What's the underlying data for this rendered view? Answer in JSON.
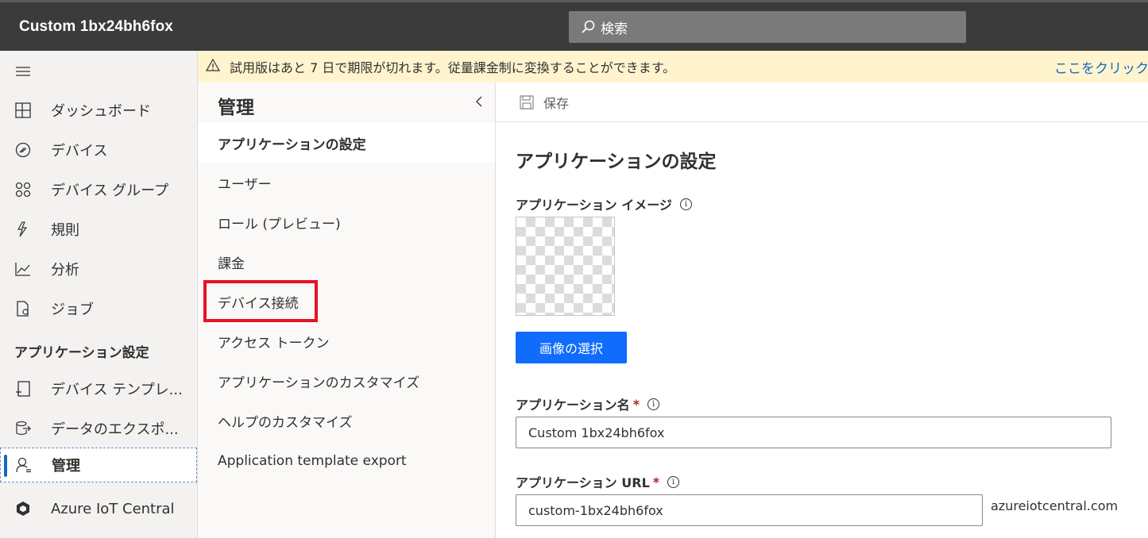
{
  "app": {
    "title": "Custom 1bx24bh6fox"
  },
  "search": {
    "placeholder": "検索"
  },
  "banner": {
    "message": "試用版はあと 7 日で期限が切れます。従量課金制に変換することができます。",
    "link": "ここをクリック"
  },
  "leftnav": {
    "items": [
      {
        "label": "ダッシュボード",
        "icon": "dashboard-icon"
      },
      {
        "label": "デバイス",
        "icon": "device-icon"
      },
      {
        "label": "デバイス グループ",
        "icon": "device-group-icon"
      },
      {
        "label": "規則",
        "icon": "rules-icon"
      },
      {
        "label": "分析",
        "icon": "analytics-icon"
      },
      {
        "label": "ジョブ",
        "icon": "jobs-icon"
      }
    ],
    "section_label": "アプリケーション設定",
    "settings_items": [
      {
        "label": "デバイス テンプレ...",
        "icon": "device-template-icon"
      },
      {
        "label": "データのエクスポ...",
        "icon": "data-export-icon"
      },
      {
        "label": "管理",
        "icon": "admin-icon",
        "active": true
      },
      {
        "label": "Azure IoT Central",
        "icon": "iot-central-icon"
      }
    ]
  },
  "subnav": {
    "title": "管理",
    "items": [
      {
        "label": "アプリケーションの設定",
        "selected": true
      },
      {
        "label": "ユーザー"
      },
      {
        "label": "ロール (プレビュー)"
      },
      {
        "label": "課金"
      },
      {
        "label": "デバイス接続"
      },
      {
        "label": "アクセス トークン"
      },
      {
        "label": "アプリケーションのカスタマイズ"
      },
      {
        "label": "ヘルプのカスタマイズ"
      },
      {
        "label": "Application template export"
      }
    ]
  },
  "toolbar": {
    "save_label": "保存"
  },
  "main": {
    "title": "アプリケーションの設定",
    "image_label": "アプリケーション イメージ",
    "select_image_label": "画像の選択",
    "name_label": "アプリケーション名",
    "name_value": "Custom 1bx24bh6fox",
    "url_label": "アプリケーション URL",
    "url_value": "custom-1bx24bh6fox",
    "url_suffix": "azureiotcentral.com",
    "required_mark": "*",
    "info_glyph": "i"
  },
  "colors": {
    "topbar": "#3b3b3b",
    "banner": "#fff4ce",
    "primary": "#0f6cfd",
    "highlight": "#e81123"
  }
}
